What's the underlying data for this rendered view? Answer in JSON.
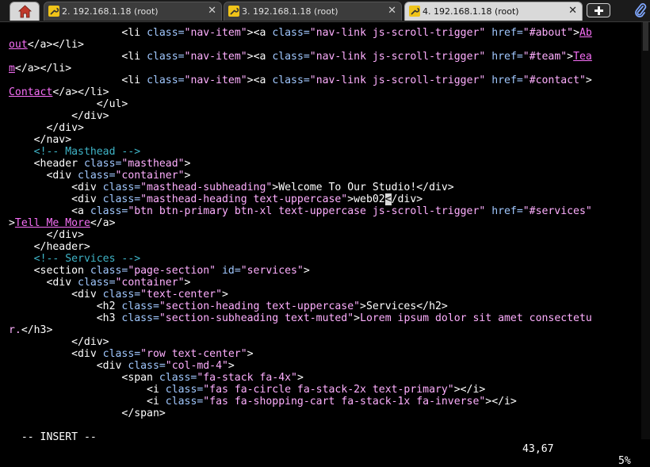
{
  "tabs": [
    {
      "label": "2. 192.168.1.18 (root)",
      "active": false
    },
    {
      "label": "3. 192.168.1.18 (root)",
      "active": false
    },
    {
      "label": "4. 192.168.1.18 (root)",
      "active": true
    }
  ],
  "icons": {
    "home": "home-icon",
    "tab": "wrench-icon",
    "close": "close-icon",
    "new_tab": "plus-icon",
    "attach": "paperclip-icon"
  },
  "colors": {
    "background": "#000000",
    "text": "#ffffff",
    "attribute": "#a1c8ff",
    "string": "#ffafff",
    "comment": "#3fb5c8",
    "link": "#f76ff7",
    "cursor": "#d8d8d8"
  },
  "editor": {
    "lines": [
      [
        {
          "t": "                  ",
          "c": "t"
        },
        {
          "t": "<li ",
          "c": "t"
        },
        {
          "t": "class=",
          "c": "at"
        },
        {
          "t": "\"nav-item\"",
          "c": "str"
        },
        {
          "t": "><a ",
          "c": "t"
        },
        {
          "t": "class=",
          "c": "at"
        },
        {
          "t": "\"nav-link js-scroll-trigger\" ",
          "c": "str"
        },
        {
          "t": "href=",
          "c": "at"
        },
        {
          "t": "\"#about\"",
          "c": "str"
        },
        {
          "t": ">",
          "c": "t"
        },
        {
          "t": "Ab",
          "c": "ul"
        }
      ],
      [
        {
          "t": "out",
          "c": "ul"
        },
        {
          "t": "</a></li>",
          "c": "t"
        }
      ],
      [
        {
          "t": "                  ",
          "c": "t"
        },
        {
          "t": "<li ",
          "c": "t"
        },
        {
          "t": "class=",
          "c": "at"
        },
        {
          "t": "\"nav-item\"",
          "c": "str"
        },
        {
          "t": "><a ",
          "c": "t"
        },
        {
          "t": "class=",
          "c": "at"
        },
        {
          "t": "\"nav-link js-scroll-trigger\" ",
          "c": "str"
        },
        {
          "t": "href=",
          "c": "at"
        },
        {
          "t": "\"#team\"",
          "c": "str"
        },
        {
          "t": ">",
          "c": "t"
        },
        {
          "t": "Tea",
          "c": "ul"
        }
      ],
      [
        {
          "t": "m",
          "c": "ul"
        },
        {
          "t": "</a></li>",
          "c": "t"
        }
      ],
      [
        {
          "t": "                  ",
          "c": "t"
        },
        {
          "t": "<li ",
          "c": "t"
        },
        {
          "t": "class=",
          "c": "at"
        },
        {
          "t": "\"nav-item\"",
          "c": "str"
        },
        {
          "t": "><a ",
          "c": "t"
        },
        {
          "t": "class=",
          "c": "at"
        },
        {
          "t": "\"nav-link js-scroll-trigger\" ",
          "c": "str"
        },
        {
          "t": "href=",
          "c": "at"
        },
        {
          "t": "\"#contact\"",
          "c": "str"
        },
        {
          "t": ">",
          "c": "t"
        }
      ],
      [
        {
          "t": "Contact",
          "c": "ul"
        },
        {
          "t": "</a></li>",
          "c": "t"
        }
      ],
      [
        {
          "t": "              </ul>",
          "c": "t"
        }
      ],
      [
        {
          "t": "          </div>",
          "c": "t"
        }
      ],
      [
        {
          "t": "      </div>",
          "c": "t"
        }
      ],
      [
        {
          "t": "    </nav>",
          "c": "t"
        }
      ],
      [
        {
          "t": "    ",
          "c": "t"
        },
        {
          "t": "<!-- Masthead -->",
          "c": "cm"
        }
      ],
      [
        {
          "t": "    <header ",
          "c": "t"
        },
        {
          "t": "class=",
          "c": "at"
        },
        {
          "t": "\"masthead\"",
          "c": "str"
        },
        {
          "t": ">",
          "c": "t"
        }
      ],
      [
        {
          "t": "      <div ",
          "c": "t"
        },
        {
          "t": "class=",
          "c": "at"
        },
        {
          "t": "\"container\"",
          "c": "str"
        },
        {
          "t": ">",
          "c": "t"
        }
      ],
      [
        {
          "t": "          <div ",
          "c": "t"
        },
        {
          "t": "class=",
          "c": "at"
        },
        {
          "t": "\"masthead-subheading\"",
          "c": "str"
        },
        {
          "t": ">Welcome To Our Studio!</div>",
          "c": "t"
        }
      ],
      [
        {
          "t": "          <div ",
          "c": "t"
        },
        {
          "t": "class=",
          "c": "at"
        },
        {
          "t": "\"masthead-heading text-uppercase\"",
          "c": "str"
        },
        {
          "t": ">web02",
          "c": "t"
        },
        {
          "t": "<",
          "c": "cur"
        },
        {
          "t": "/div>",
          "c": "t"
        }
      ],
      [
        {
          "t": "          <a ",
          "c": "t"
        },
        {
          "t": "class=",
          "c": "at"
        },
        {
          "t": "\"btn btn-primary btn-xl text-uppercase js-scroll-trigger\" ",
          "c": "str"
        },
        {
          "t": "href=",
          "c": "at"
        },
        {
          "t": "\"#services\"",
          "c": "str"
        }
      ],
      [
        {
          "t": ">",
          "c": "t"
        },
        {
          "t": "Tell Me More",
          "c": "ul"
        },
        {
          "t": "</a>",
          "c": "t"
        }
      ],
      [
        {
          "t": "      </div>",
          "c": "t"
        }
      ],
      [
        {
          "t": "    </header>",
          "c": "t"
        }
      ],
      [
        {
          "t": "    ",
          "c": "t"
        },
        {
          "t": "<!-- Services -->",
          "c": "cm"
        }
      ],
      [
        {
          "t": "    <section ",
          "c": "t"
        },
        {
          "t": "class=",
          "c": "at"
        },
        {
          "t": "\"page-section\" ",
          "c": "str"
        },
        {
          "t": "id=",
          "c": "at"
        },
        {
          "t": "\"services\"",
          "c": "str"
        },
        {
          "t": ">",
          "c": "t"
        }
      ],
      [
        {
          "t": "      <div ",
          "c": "t"
        },
        {
          "t": "class=",
          "c": "at"
        },
        {
          "t": "\"container\"",
          "c": "str"
        },
        {
          "t": ">",
          "c": "t"
        }
      ],
      [
        {
          "t": "          <div ",
          "c": "t"
        },
        {
          "t": "class=",
          "c": "at"
        },
        {
          "t": "\"text-center\"",
          "c": "str"
        },
        {
          "t": ">",
          "c": "t"
        }
      ],
      [
        {
          "t": "              <h2 ",
          "c": "t"
        },
        {
          "t": "class=",
          "c": "at"
        },
        {
          "t": "\"section-heading text-uppercase\"",
          "c": "str"
        },
        {
          "t": ">Services</h2>",
          "c": "t"
        }
      ],
      [
        {
          "t": "              <h3 ",
          "c": "t"
        },
        {
          "t": "class=",
          "c": "at"
        },
        {
          "t": "\"section-subheading text-muted\"",
          "c": "str"
        },
        {
          "t": ">",
          "c": "t"
        },
        {
          "t": "Lorem ipsum dolor sit amet consectetu",
          "c": "str"
        }
      ],
      [
        {
          "t": "r.",
          "c": "str"
        },
        {
          "t": "</h3>",
          "c": "t"
        }
      ],
      [
        {
          "t": "          </div>",
          "c": "t"
        }
      ],
      [
        {
          "t": "          <div ",
          "c": "t"
        },
        {
          "t": "class=",
          "c": "at"
        },
        {
          "t": "\"row text-center\"",
          "c": "str"
        },
        {
          "t": ">",
          "c": "t"
        }
      ],
      [
        {
          "t": "              <div ",
          "c": "t"
        },
        {
          "t": "class=",
          "c": "at"
        },
        {
          "t": "\"col-md-4\"",
          "c": "str"
        },
        {
          "t": ">",
          "c": "t"
        }
      ],
      [
        {
          "t": "                  <span ",
          "c": "t"
        },
        {
          "t": "class=",
          "c": "at"
        },
        {
          "t": "\"fa-stack fa-4x\"",
          "c": "str"
        },
        {
          "t": ">",
          "c": "t"
        }
      ],
      [
        {
          "t": "                      <i ",
          "c": "t"
        },
        {
          "t": "class=",
          "c": "at"
        },
        {
          "t": "\"fas fa-circle fa-stack-2x text-primary\"",
          "c": "str"
        },
        {
          "t": "></i>",
          "c": "t"
        }
      ],
      [
        {
          "t": "                      <i ",
          "c": "t"
        },
        {
          "t": "class=",
          "c": "at"
        },
        {
          "t": "\"fas fa-shopping-cart fa-stack-1x fa-inverse\"",
          "c": "str"
        },
        {
          "t": "></i>",
          "c": "t"
        }
      ],
      [
        {
          "t": "                  </span>",
          "c": "t"
        }
      ]
    ]
  },
  "status": {
    "mode": "-- INSERT --",
    "position": "43,67",
    "percent": "5%"
  }
}
